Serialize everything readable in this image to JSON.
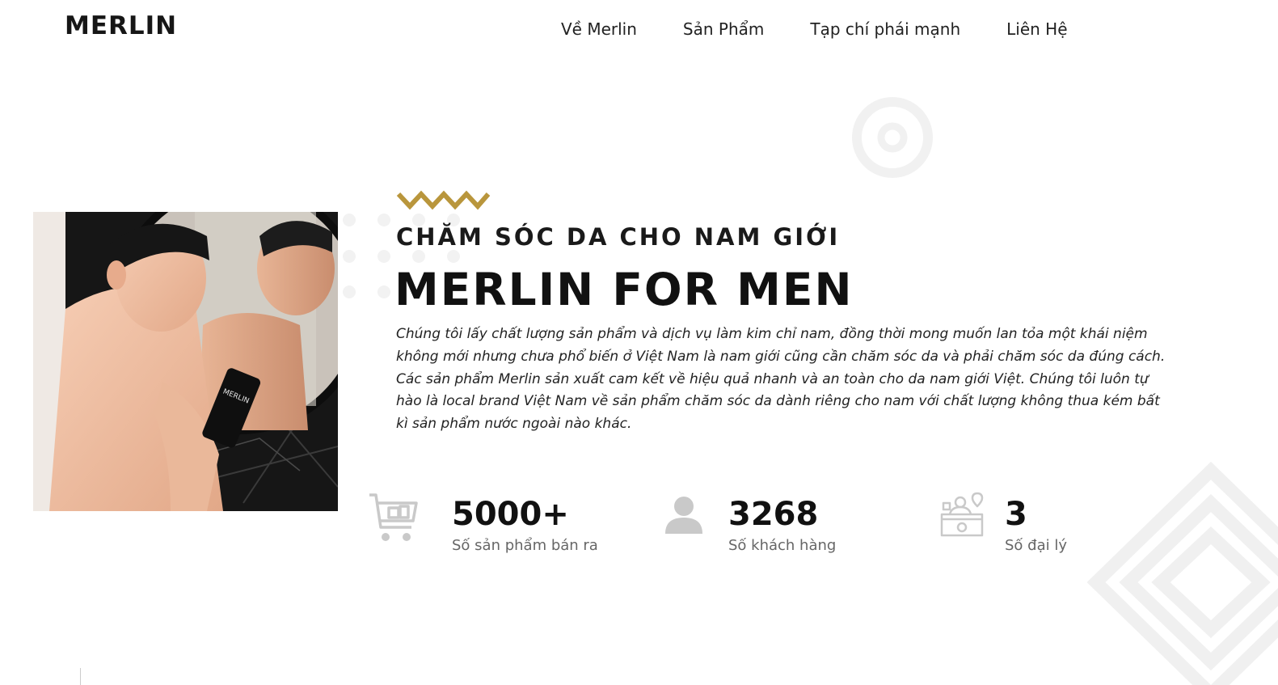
{
  "header": {
    "logo": "MERLIN",
    "nav": [
      {
        "label": "Về Merlin"
      },
      {
        "label": "Sản Phẩm"
      },
      {
        "label": "Tạp chí phái mạnh"
      },
      {
        "label": "Liên Hệ"
      }
    ]
  },
  "hero": {
    "eyebrow": "CHĂM SÓC DA CHO NAM GIỚI",
    "title": "MERLIN FOR MEN",
    "paragraphs": [
      "Chúng tôi lấy chất lượng sản phẩm và dịch vụ làm kim chỉ nam, đồng thời mong muốn lan tỏa một khái niệm không mới nhưng chưa phổ biến ở Việt Nam là nam giới cũng cần chăm sóc da và phải chăm sóc da đúng cách.",
      "Các sản phẩm Merlin sản xuất cam kết về hiệu quả nhanh và an toàn cho da nam giới Việt. Chúng tôi luôn tự hào là local brand Việt Nam về sản phẩm chăm sóc da dành riêng cho nam với chất lượng không thua kém bất kì sản phẩm nước ngoài nào khác."
    ],
    "product_label": "MERLIN"
  },
  "stats": [
    {
      "icon": "shopping-cart-icon",
      "value": "5000+",
      "label": "Số sản phẩm bán ra"
    },
    {
      "icon": "user-icon",
      "value": "3268",
      "label": "Số khách hàng"
    },
    {
      "icon": "agency-desk-icon",
      "value": "3",
      "label": "Số đại lý"
    }
  ],
  "colors": {
    "accent": "#b9963c",
    "text": "#111111",
    "muted": "#666666",
    "icon": "#c9c9c9",
    "decoration": "#f2f2f2"
  }
}
